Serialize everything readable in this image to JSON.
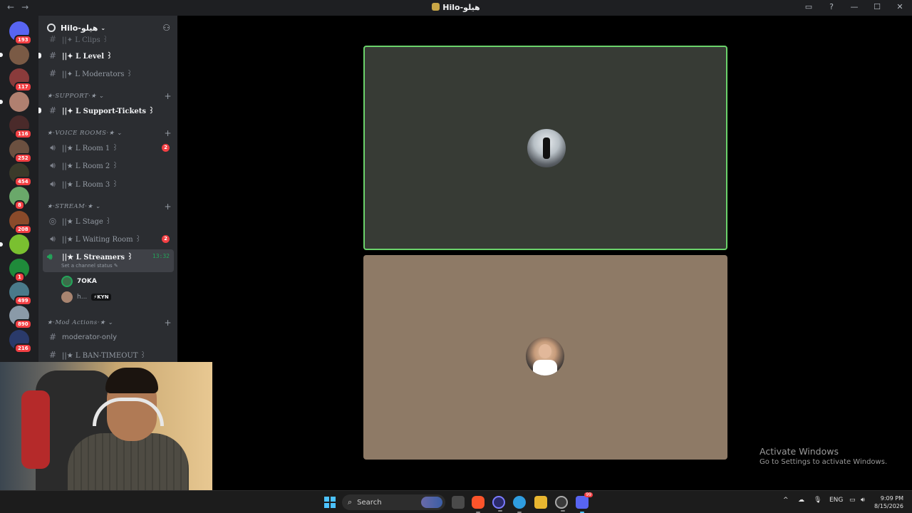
{
  "titlebar": {
    "title": "Hilo-هيلو",
    "back": "←",
    "forward": "→"
  },
  "guilds": [
    {
      "badge": "193"
    },
    {
      "badge": ""
    },
    {
      "badge": "117"
    },
    {
      "badge": ""
    },
    {
      "badge": "116"
    },
    {
      "badge": "252"
    },
    {
      "badge": "454"
    },
    {
      "badge": "8"
    },
    {
      "badge": "208"
    },
    {
      "badge": ""
    },
    {
      "badge": "1"
    },
    {
      "badge": "499"
    },
    {
      "badge": "890"
    },
    {
      "badge": "216"
    }
  ],
  "server": {
    "name": "Hilo-هيلو"
  },
  "channels": {
    "partial_top": "||✦ L Clips ꒱",
    "level": "||✦ L Level ꒱",
    "moderators": "||✦ L Moderators ꒱",
    "cat_support": "★·SUPPORT·★",
    "support_tickets": "||✦ L Support-Tickets ꒱",
    "cat_voice": "★·VOICE ROOMS·★",
    "room1": "||★ L Room 1 ꒱",
    "room1_count": "2",
    "room2": "||★ L Room 2 ꒱",
    "room3": "||★ L Room 3 ꒱",
    "cat_stream": "★·STREAM·★",
    "stage": "||★ L Stage ꒱",
    "waiting_room": "||★ L Waiting Room ꒱",
    "waiting_count": "2",
    "streamers": "||★ L Streamers ꒱",
    "streamers_time": "13:32",
    "streamers_status": "Set a channel status",
    "member1": "7OKA",
    "member2": "h...",
    "member2_tag": "⚡KYN",
    "cat_mod": "★·Mod Actions·★",
    "moderator_only": "moderator-only",
    "ban_timeout": "||★ L BAN-TIMEOUT ꒱"
  },
  "watermark": {
    "line1": "Activate Windows",
    "line2": "Go to Settings to activate Windows."
  },
  "taskbar": {
    "search_label": "Search",
    "language": "ENG",
    "time": "9:09 PM",
    "date": "8/15/2026",
    "discord_badge": "99"
  },
  "colors": {
    "speaking_border": "#6bd36b",
    "tile1_bg": "#373b35",
    "tile2_bg": "#8e7a66",
    "accent_green": "#23a55a",
    "badge_red": "#f23f43"
  }
}
